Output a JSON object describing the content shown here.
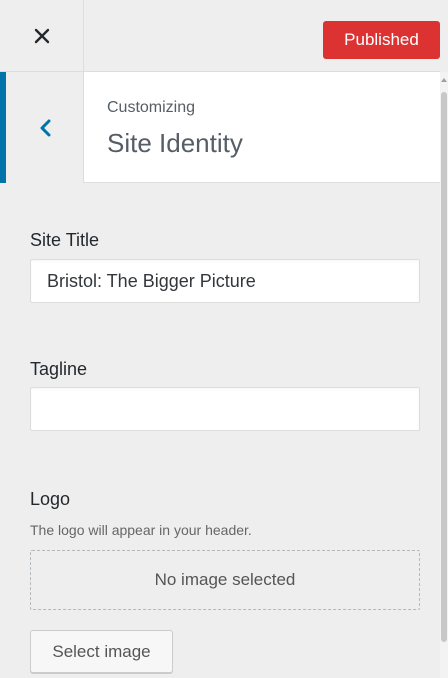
{
  "topbar": {
    "close_icon": "close-icon",
    "publish_label": "Published",
    "publish_color": "#dc3232"
  },
  "section": {
    "eyebrow": "Customizing",
    "title": "Site Identity",
    "back_icon": "chevron-left-icon",
    "accent": "#0073aa"
  },
  "controls": {
    "site_title": {
      "label": "Site Title",
      "value": "Bristol: The Bigger Picture"
    },
    "tagline": {
      "label": "Tagline",
      "value": ""
    },
    "logo": {
      "label": "Logo",
      "description": "The logo will appear in your header.",
      "placeholder": "No image selected",
      "button_label": "Select image"
    }
  }
}
